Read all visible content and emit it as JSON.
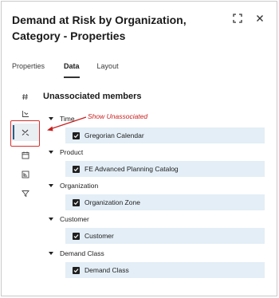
{
  "header": {
    "title": "Demand at Risk by Organization, Category - Properties"
  },
  "tabs": [
    {
      "label": "Properties"
    },
    {
      "label": "Data"
    },
    {
      "label": "Layout"
    }
  ],
  "active_tab": "Data",
  "rail": {
    "items": [
      {
        "icon": "hash-icon"
      },
      {
        "icon": "axis-icon"
      },
      {
        "icon": "unassociated-members-icon",
        "active": true
      },
      {
        "icon": "calendar-icon"
      },
      {
        "icon": "hierarchy-icon"
      },
      {
        "icon": "filter-icon"
      }
    ]
  },
  "annotation": {
    "text": "Show Unassociated",
    "color": "#c8201f"
  },
  "section": {
    "title": "Unassociated members"
  },
  "groups": [
    {
      "name": "Time",
      "member": "Gregorian Calendar",
      "checked": true
    },
    {
      "name": "Product",
      "member": "FE Advanced Planning Catalog",
      "checked": true
    },
    {
      "name": "Organization",
      "member": "Organization Zone",
      "checked": true
    },
    {
      "name": "Customer",
      "member": "Customer",
      "checked": true
    },
    {
      "name": "Demand Class",
      "member": "Demand Class",
      "checked": true
    }
  ],
  "colors": {
    "row_background": "#e3eef6",
    "active_indicator": "#2b5d86",
    "highlight_border": "#d9302c"
  }
}
